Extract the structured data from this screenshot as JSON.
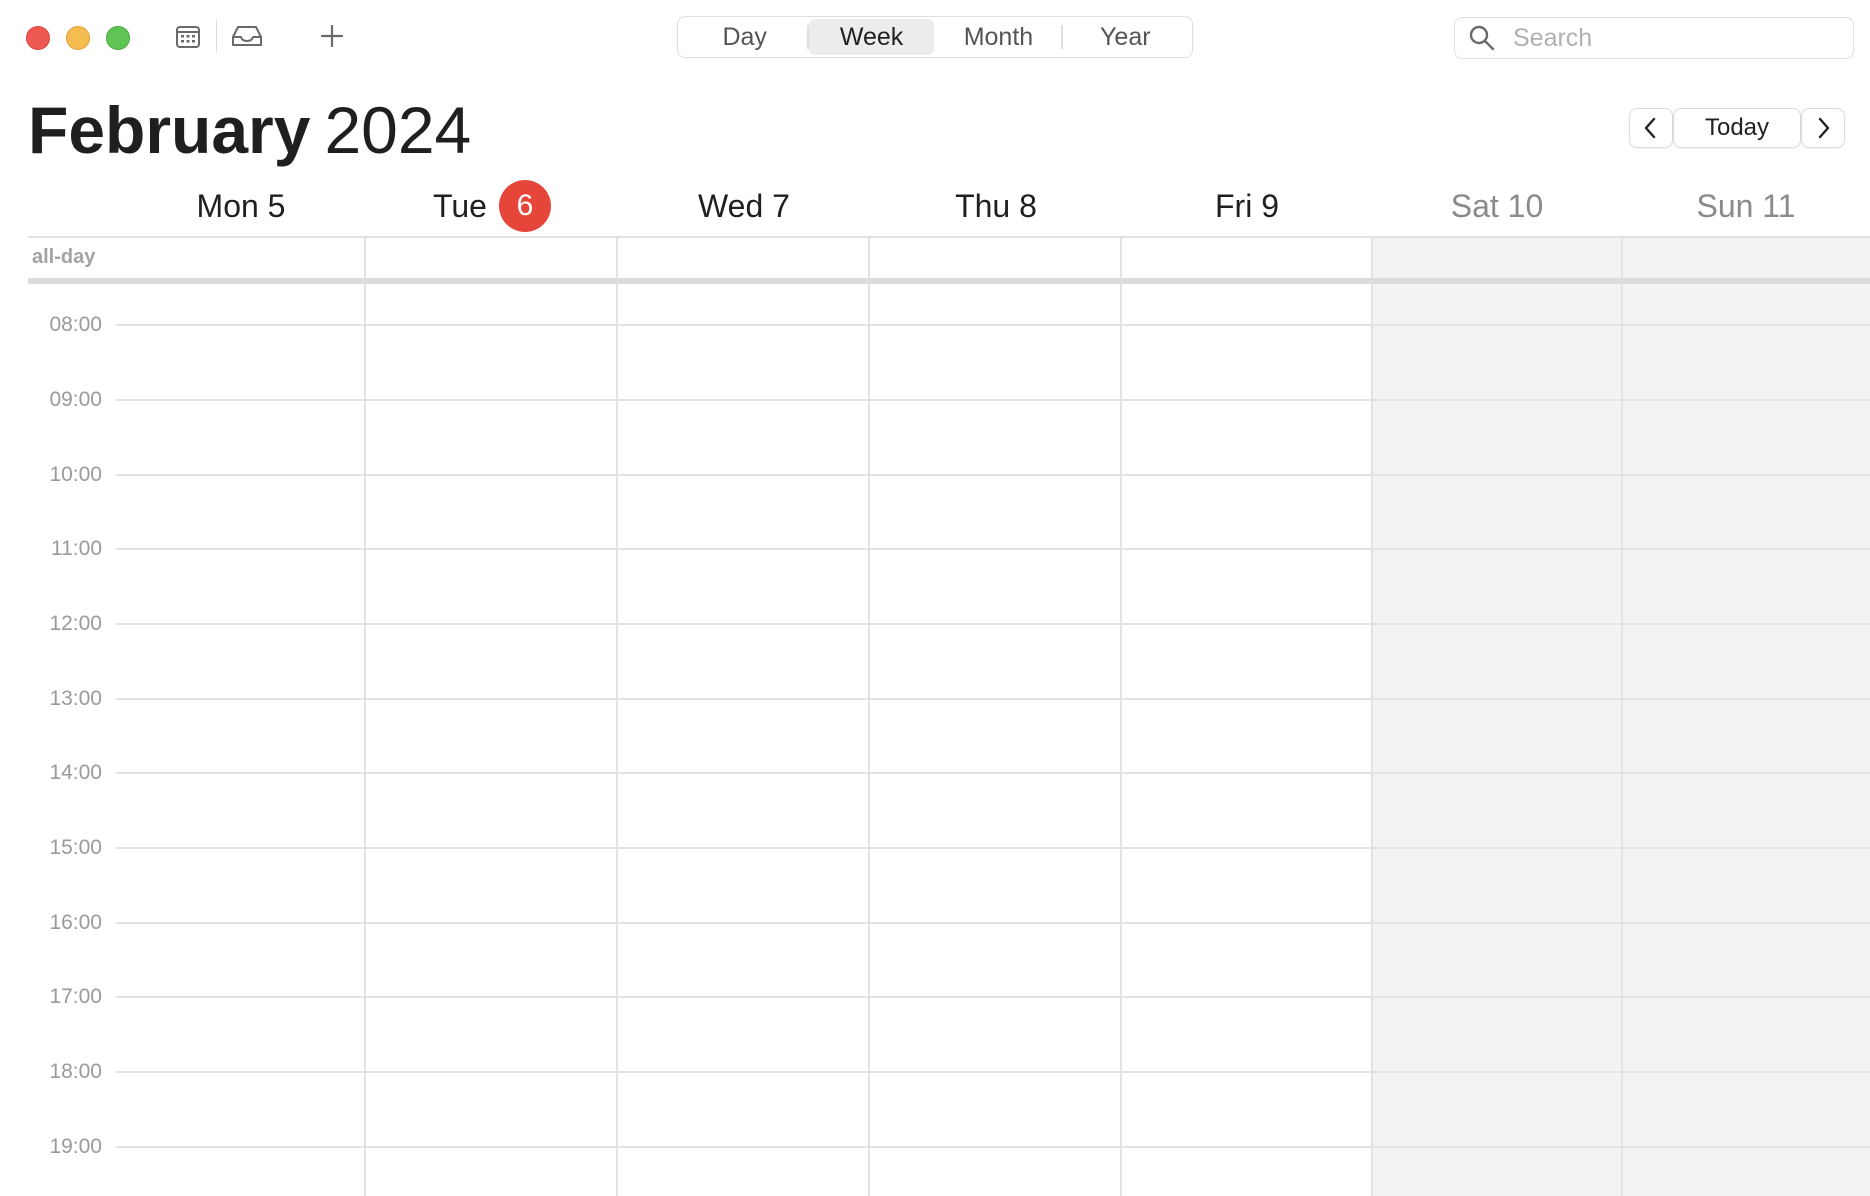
{
  "toolbar": {
    "traffic_lights": {
      "close_color": "#ee5a52",
      "minimize_color": "#f5bd4f",
      "zoom_color": "#5fc454"
    },
    "calendars_icon": "calendar-list-icon",
    "inbox_icon": "inbox-tray-icon",
    "add_icon": "plus-icon",
    "view_tabs": [
      {
        "label": "Day",
        "active": false
      },
      {
        "label": "Week",
        "active": true
      },
      {
        "label": "Month",
        "active": false
      },
      {
        "label": "Year",
        "active": false
      }
    ],
    "search": {
      "placeholder": "Search",
      "value": ""
    }
  },
  "header": {
    "month": "February",
    "year": "2024",
    "today_label": "Today"
  },
  "days": [
    {
      "label": "Mon 5",
      "today": false,
      "weekend": false
    },
    {
      "label": "Tue",
      "today": true,
      "today_number": "6",
      "weekend": false
    },
    {
      "label": "Wed 7",
      "today": false,
      "weekend": false
    },
    {
      "label": "Thu 8",
      "today": false,
      "weekend": false
    },
    {
      "label": "Fri 9",
      "today": false,
      "weekend": false
    },
    {
      "label": "Sat 10",
      "today": false,
      "weekend": true
    },
    {
      "label": "Sun 11",
      "today": false,
      "weekend": true
    }
  ],
  "all_day_label": "all-day",
  "hours": [
    "08:00",
    "09:00",
    "10:00",
    "11:00",
    "12:00",
    "13:00",
    "14:00",
    "15:00",
    "16:00",
    "17:00",
    "18:00",
    "19:00"
  ],
  "colors": {
    "today_badge": "#e6463a",
    "weekend_background": "#f3f3f3"
  }
}
